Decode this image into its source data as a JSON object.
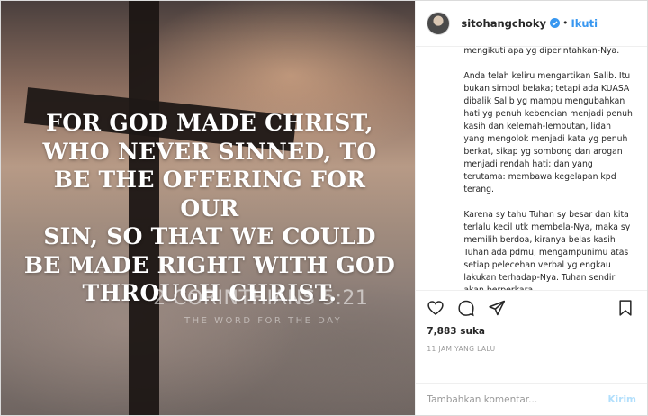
{
  "post_image": {
    "verse_lines": [
      "FOR GOD MADE CHRIST,",
      "WHO NEVER SINNED, TO",
      "BE THE OFFERING FOR OUR",
      "SIN, SO THAT WE COULD",
      "BE MADE RIGHT WITH GOD",
      "THROUGH CHRIST."
    ],
    "reference": "2 CORINTHIANS 5:21",
    "tagline": "THE WORD FOR THE DAY"
  },
  "header": {
    "username": "sitohangchoky",
    "follow_label": "Ikuti",
    "separator": "•"
  },
  "caption": {
    "paragraphs": [
      "mengikuti apa yg diperintahkan-Nya.",
      "Anda telah keliru mengartikan Salib. Itu bukan simbol belaka; tetapi ada KUASA dibalik Salib yg mampu mengubahkan hati yg penuh kebencian menjadi penuh kasih dan kelemah-lembutan, lidah yang mengolok menjadi kata yg penuh berkat, sikap yg sombong dan arogan menjadi rendah hati; dan yang terutama: membawa kegelapan kpd terang.",
      "Karena sy tahu Tuhan sy besar dan kita terlalu kecil utk membela-Nya, maka sy memilih berdoa, kiranya belas kasih Tuhan ada pdmu, mengampunimu atas setiap pelecehan verbal yg engkau lakukan terhadap-Nya. Tuhan sendiri akan berperkara"
    ]
  },
  "actions": {
    "likes": "7,883 suka",
    "timestamp": "11 JAM YANG LALU"
  },
  "comment": {
    "placeholder": "Tambahkan komentar...",
    "post_label": "Kirim"
  },
  "colors": {
    "accent": "#3897f0",
    "post_disabled": "#b2dffc",
    "muted": "#999999",
    "text": "#262626"
  },
  "icons": [
    "verified-badge-icon",
    "heart-icon",
    "comment-icon",
    "share-icon",
    "bookmark-icon"
  ]
}
